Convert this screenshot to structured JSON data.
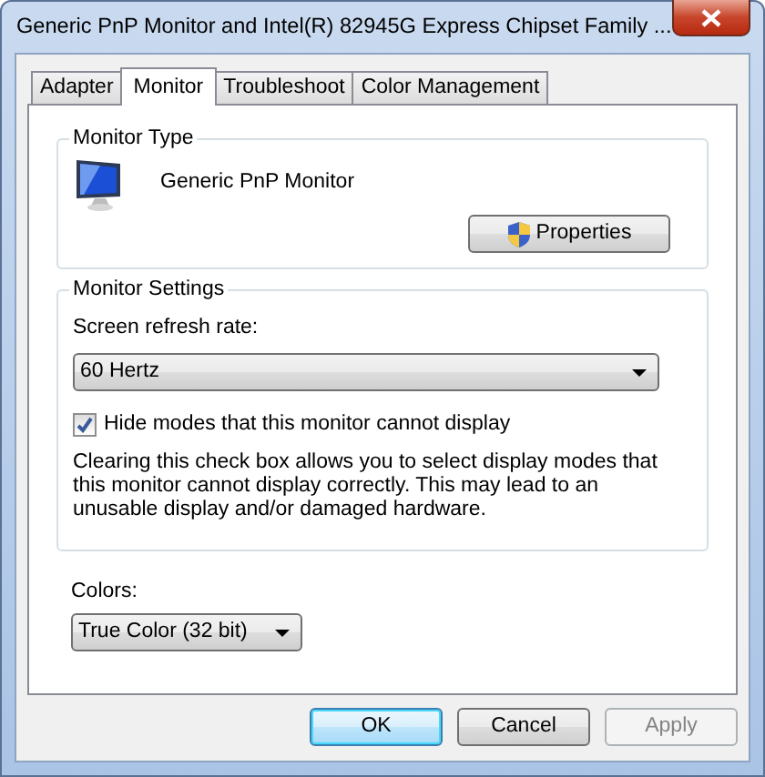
{
  "window": {
    "title": "Generic PnP Monitor and Intel(R) 82945G Express Chipset Family ..."
  },
  "tabs": [
    {
      "label": "Adapter",
      "selected": false
    },
    {
      "label": "Monitor",
      "selected": true
    },
    {
      "label": "Troubleshoot",
      "selected": false
    },
    {
      "label": "Color Management",
      "selected": false
    }
  ],
  "monitor_type": {
    "legend": "Monitor Type",
    "device_name": "Generic PnP Monitor",
    "properties_button": "Properties"
  },
  "monitor_settings": {
    "legend": "Monitor Settings",
    "refresh_label": "Screen refresh rate:",
    "refresh_value": "60 Hertz",
    "hide_modes": {
      "label": "Hide modes that this monitor cannot display",
      "checked": true
    },
    "warning": "Clearing this check box allows you to select display modes that this monitor cannot display correctly. This may lead to an unusable display and/or damaged hardware."
  },
  "colors": {
    "label": "Colors:",
    "value": "True Color (32 bit)"
  },
  "buttons": [
    {
      "label": "OK",
      "default": true,
      "disabled": false
    },
    {
      "label": "Cancel",
      "default": false,
      "disabled": false
    },
    {
      "label": "Apply",
      "default": false,
      "disabled": true
    }
  ]
}
